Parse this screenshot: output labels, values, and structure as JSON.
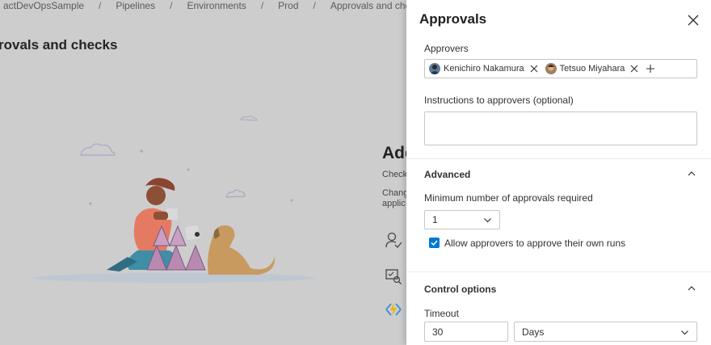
{
  "breadcrumbs": [
    "actDevOpsSample",
    "Pipelines",
    "Environments",
    "Prod",
    "Approvals and checks"
  ],
  "page": {
    "heading": "rovals and checks",
    "right_heading": "Add",
    "right_line_1": "Check",
    "right_line_2": "Chang",
    "right_line_3": "applic"
  },
  "panel": {
    "title": "Approvals",
    "approvers_label": "Approvers",
    "approvers": [
      {
        "name": "Kenichiro Nakamura"
      },
      {
        "name": "Tetsuo Miyahara"
      }
    ],
    "instructions_label": "Instructions to approvers (optional)",
    "instructions_value": "",
    "advanced": {
      "heading": "Advanced",
      "min_approvals_label": "Minimum number of approvals required",
      "min_approvals_value": "1",
      "allow_self_approve_label": "Allow approvers to approve their own runs",
      "allow_self_approve_checked": true
    },
    "control": {
      "heading": "Control options",
      "timeout_label": "Timeout",
      "timeout_value": "30",
      "timeout_unit": "Days"
    }
  },
  "colors": {
    "accent": "#0078d4",
    "overlay": "#cdcdcd",
    "panel_bg": "#ffffff"
  },
  "icons": [
    "close-icon",
    "chip-remove-icon",
    "add-icon",
    "chevron-up-icon",
    "chevron-down-icon",
    "checkmark-icon",
    "user-check-icon",
    "monitor-check-icon",
    "azure-function-icon"
  ]
}
